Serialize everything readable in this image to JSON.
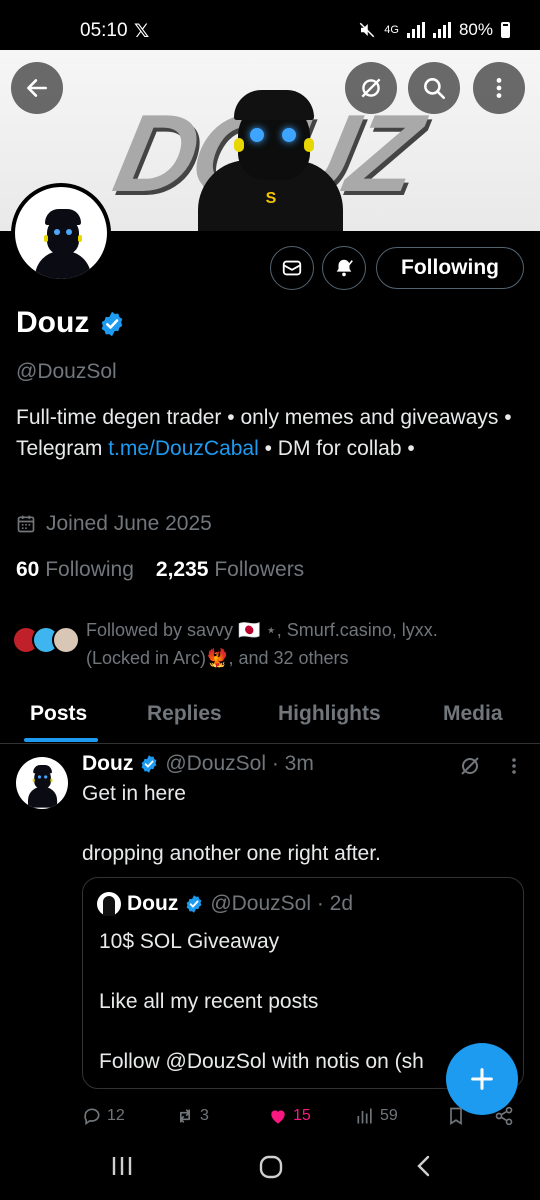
{
  "status_bar": {
    "time": "05:10",
    "x_logo": "𝕏",
    "network": "4G",
    "battery": "80%"
  },
  "banner": {
    "logo_text": "DOUZ",
    "chip_text": "S"
  },
  "profile": {
    "name": "Douz",
    "handle": "@DouzSol",
    "bio_part1": "Full-time degen trader • only memes and giveaways • Telegram ",
    "bio_link": "t.me/DouzCabal",
    "bio_part2": " • DM for collab •",
    "joined": "Joined June 2025",
    "following_count": "60",
    "following_label": "Following",
    "followers_count": "2,235",
    "followers_label": "Followers",
    "following_button": "Following",
    "followed_by": "Followed by savvy 🇯🇵 ⋆, Smurf.casino, lyxx. (Locked in Arc)🐦‍🔥, and 32 others"
  },
  "tabs": [
    "Posts",
    "Replies",
    "Highlights",
    "Media"
  ],
  "post": {
    "name": "Douz",
    "handle_time": "@DouzSol · 3m",
    "text1": "Get in here",
    "text2": "dropping another one right after.",
    "quote": {
      "name": "Douz",
      "handle_time": "@DouzSol · 2d",
      "line1": "10$ SOL Giveaway",
      "line2": "Like all my recent posts",
      "line3": "Follow @DouzSol with notis on (sh"
    },
    "replies": "12",
    "reposts": "3",
    "likes": "15",
    "views": "59"
  },
  "colors": {
    "accent": "#1d9bf0",
    "like": "#f91880",
    "muted": "#71767b"
  }
}
